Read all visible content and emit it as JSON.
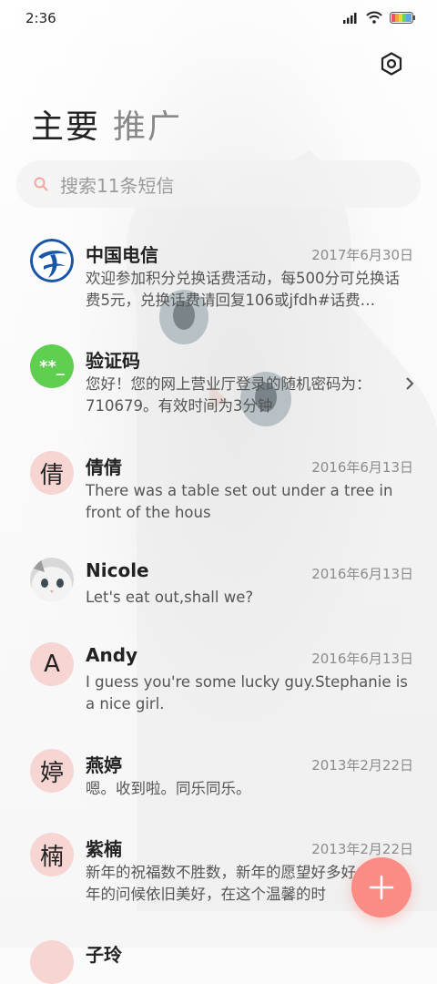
{
  "status_bar": {
    "time": "2:36"
  },
  "tabs": [
    {
      "label": "主要"
    },
    {
      "label": "推广"
    }
  ],
  "search": {
    "placeholder": "搜索11条短信"
  },
  "messages": [
    {
      "name": "中国电信",
      "date": "2017年6月30日",
      "preview": "欢迎参加积分兑换话费活动，每500分可兑换话费5元，兑换话费请回复106或jfdh#话费…"
    },
    {
      "name": "验证码",
      "avatar_text": "**_",
      "preview": "您好！您的网上营业厅登录的随机密码为：710679。有效时间为3分钟"
    },
    {
      "name": "倩倩",
      "avatar_text": "倩",
      "date": "2016年6月13日",
      "preview": "There was a table set out under a tree in front of the hous"
    },
    {
      "name": "Nicole",
      "date": "2016年6月13日",
      "preview": "Let's eat out,shall we?"
    },
    {
      "name": "Andy",
      "avatar_text": "A",
      "date": "2016年6月13日",
      "preview": "I guess you're some lucky guy.Stephanie is a nice girl."
    },
    {
      "name": "燕婷",
      "avatar_text": "婷",
      "date": "2013年2月22日",
      "preview": "嗯。收到啦。同乐同乐。"
    },
    {
      "name": "紫楠",
      "avatar_text": "楠",
      "date": "2013年2月22日",
      "preview": "新年的祝福数不胜数，新年的愿望好多好多，新年的问候依旧美好，在这个温馨的时"
    },
    {
      "name": "子玲"
    }
  ],
  "colors": {
    "accent": "#fa8b85",
    "avatar_pink": "#f6d5d2",
    "verify_green": "#5fcf50",
    "telecom_blue": "#1a56a8"
  },
  "icons": {
    "settings": "settings-hexagon-icon",
    "search": "search-icon",
    "fab": "plus-icon",
    "chevron": "chevron-right-icon"
  }
}
